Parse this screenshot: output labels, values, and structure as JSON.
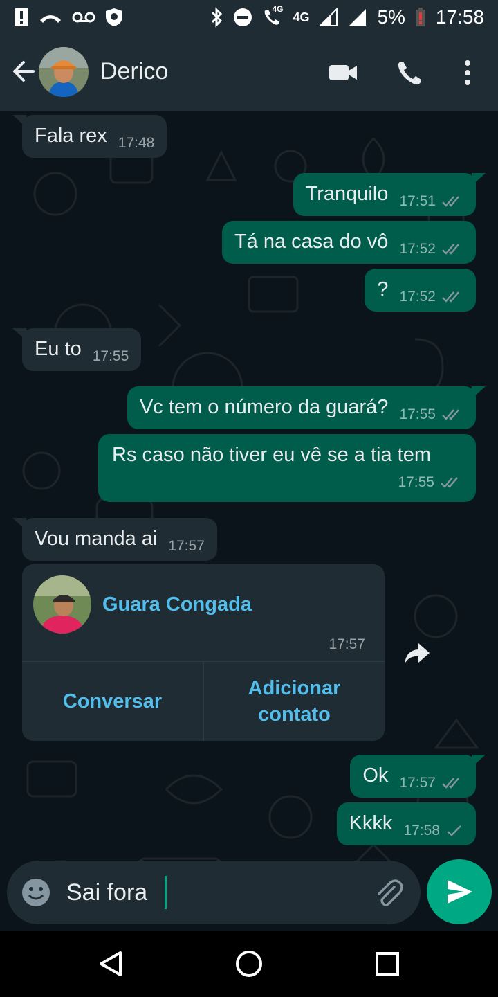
{
  "status_bar": {
    "network": "4G",
    "network2": "4G",
    "battery": "5%",
    "time": "17:58"
  },
  "header": {
    "contact_name": "Derico",
    "icons": [
      "back-arrow-icon",
      "video-call-icon",
      "voice-call-icon",
      "more-options-icon"
    ]
  },
  "messages": [
    {
      "dir": "in",
      "text": "Fala rex",
      "time": "17:48"
    },
    {
      "dir": "out",
      "text": "Tranquilo",
      "time": "17:51",
      "status": "read"
    },
    {
      "dir": "out",
      "text": "Tá na casa do vô",
      "time": "17:52",
      "status": "read"
    },
    {
      "dir": "out",
      "text": "?",
      "time": "17:52",
      "status": "read"
    },
    {
      "dir": "in",
      "text": "Eu to",
      "time": "17:55"
    },
    {
      "dir": "out",
      "text": "Vc tem o número da guará?",
      "time": "17:55",
      "status": "read"
    },
    {
      "dir": "out",
      "text": "Rs caso não tiver eu vê se a tia tem",
      "time": "17:55",
      "status": "read"
    },
    {
      "dir": "in",
      "text": "Vou manda ai",
      "time": "17:57"
    },
    {
      "dir": "out",
      "text": "Ok",
      "time": "17:57",
      "status": "read"
    },
    {
      "dir": "out",
      "text": "Kkkk",
      "time": "17:58",
      "status": "sent"
    }
  ],
  "contact_card": {
    "name": "Guara Congada",
    "time": "17:57",
    "button_chat": "Conversar",
    "button_add": "Adicionar contato"
  },
  "composer": {
    "value": "Sai fora",
    "icons": [
      "emoji-icon",
      "attach-icon",
      "send-icon"
    ]
  },
  "colors": {
    "header": "#1f2c34",
    "chat_bg": "#0b141a",
    "incoming": "#1f2c34",
    "outgoing": "#005c4b",
    "accent": "#00a884",
    "link": "#53bdeb",
    "read_tick": "#8696a0"
  }
}
